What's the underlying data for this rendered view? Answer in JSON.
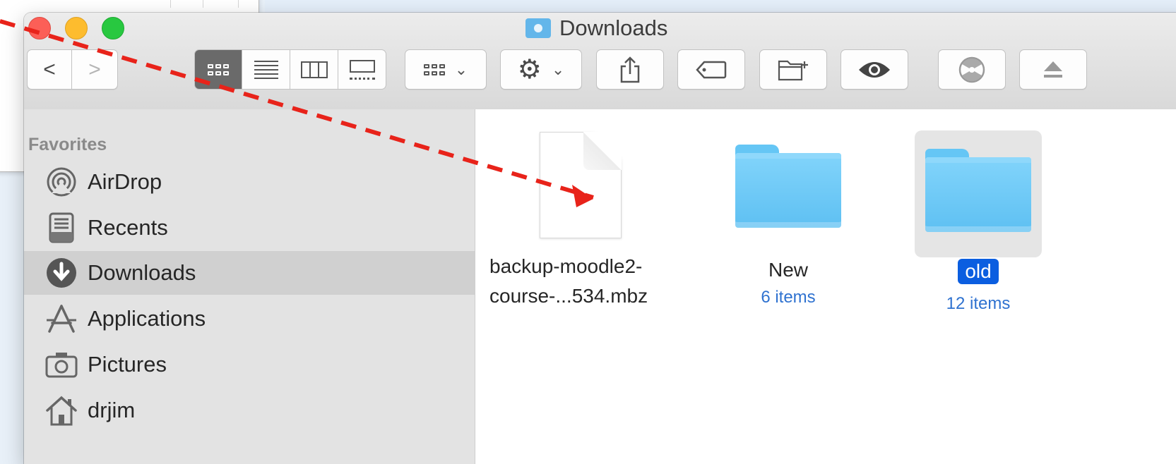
{
  "window": {
    "title": "Downloads"
  },
  "toolbar": {
    "back": "<",
    "forward": ">",
    "views": [
      "icon-view",
      "list-view",
      "column-view",
      "gallery-view"
    ],
    "group_icon": "group-by-icon",
    "action_icon": "gear-icon",
    "share_icon": "share-icon",
    "tag_icon": "tag-icon",
    "new_folder_icon": "new-folder-icon",
    "quicklook_icon": "eye-icon",
    "burn_icon": "burn-icon",
    "eject_icon": "eject-icon"
  },
  "sidebar": {
    "heading": "Favorites",
    "items": [
      {
        "label": "AirDrop",
        "icon": "airdrop-icon"
      },
      {
        "label": "Recents",
        "icon": "recents-icon"
      },
      {
        "label": "Downloads",
        "icon": "downloads-icon",
        "active": true
      },
      {
        "label": "Applications",
        "icon": "applications-icon"
      },
      {
        "label": "Pictures",
        "icon": "camera-icon"
      },
      {
        "label": "drjim",
        "icon": "home-icon"
      }
    ]
  },
  "files": [
    {
      "name_line1": "backup-moodle2-",
      "name_line2": "course-...534.mbz",
      "kind": "document"
    },
    {
      "name": "New",
      "count": "6 items",
      "kind": "folder"
    },
    {
      "name": "old",
      "count": "12 items",
      "kind": "folder",
      "selected": true
    }
  ],
  "colors": {
    "accent": "#0b5ee0",
    "annotation": "#e8231a",
    "folder": "#65c6f5"
  }
}
